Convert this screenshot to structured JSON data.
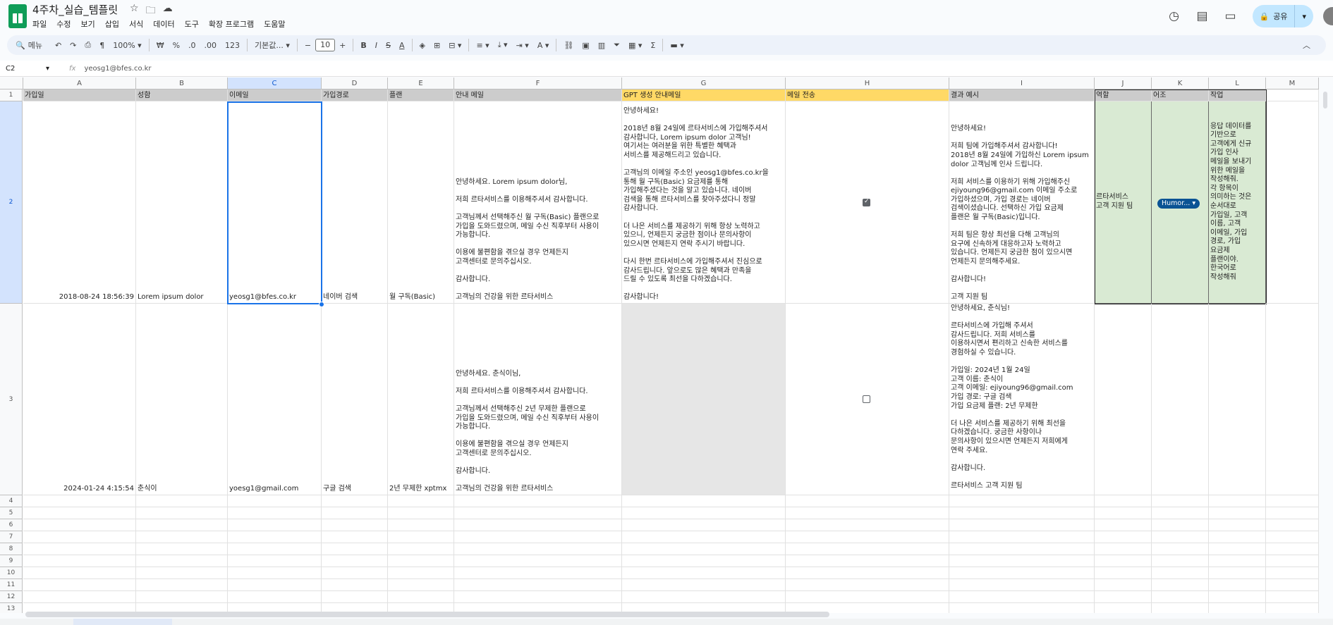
{
  "title": "4주차_실습_템플릿",
  "title_icons": [
    "star-icon",
    "folder-icon",
    "cloud-icon"
  ],
  "menu": [
    "파일",
    "수정",
    "보기",
    "삽입",
    "서식",
    "데이터",
    "도구",
    "확장 프로그램",
    "도움말"
  ],
  "share_label": "공유",
  "toolbar": {
    "search": "메뉴",
    "zoom": "100%",
    "currency": "₩",
    "percent": "%",
    "dec_decrease": ".0",
    "dec_increase": ".00",
    "number_format": "123",
    "font": "기본값...",
    "font_size": "10"
  },
  "name_box": "C2",
  "formula_value": "yeosg1@bfes.co.kr",
  "columns": [
    "A",
    "B",
    "C",
    "D",
    "E",
    "F",
    "G",
    "H",
    "I",
    "J",
    "K",
    "L",
    "M"
  ],
  "row_numbers": [
    "1",
    "2",
    "3",
    "4",
    "5",
    "6",
    "7",
    "8",
    "9",
    "10",
    "11",
    "12",
    "13"
  ],
  "headers": [
    "가입일",
    "성함",
    "이메일",
    "가입경로",
    "플랜",
    "안내 메일",
    "GPT 생성 안내메일",
    "메일 전송",
    "결과 예시",
    "역할",
    "어조",
    "작업"
  ],
  "row2": {
    "date": "2018-08-24 18:56:39",
    "name": "Lorem ipsum dolor",
    "email": "yeosg1@bfes.co.kr",
    "route": "네이버 검색",
    "plan": "월 구독(Basic)",
    "mail": "안녕하세요. Lorem ipsum dolor님,\n\n저희 르타서비스를 이용해주셔서 감사합니다.\n\n고객님께서 선택해주신 월 구독(Basic) 플랜으로\n가입을 도와드렸으며, 메일 수신 직후부터 사용이\n가능합니다.\n\n이용에 불편함을 겪으실 경우 언제든지\n고객센터로 문의주십시오.\n\n감사합니다.\n\n고객님의 건강을 위한 르타서비스",
    "gpt": "안녕하세요!\n\n2018년 8월 24일에 르타서비스에 가입해주셔서\n감사합니다, Lorem ipsum dolor 고객님!\n여기서는 여러분을 위한 특별한 혜택과\n서비스를 제공해드리고 있습니다.\n\n고객님의 이메일 주소인 yeosg1@bfes.co.kr을\n통해 월 구독(Basic) 요금제를 통해\n가입해주셨다는 것을 알고 있습니다. 네이버\n검색을 통해 르타서비스를 찾아주셨다니 정말\n감사합니다.\n\n더 나은 서비스를 제공하기 위해 항상 노력하고\n있으니, 언제든지 궁금한 점이나 문의사항이\n있으시면 언제든지 연락 주시기 바랍니다.\n\n다시 한번 르타서비스에 가입해주셔서 진심으로\n감사드립니다. 앞으로도 많은 혜택과 만족을\n드릴 수 있도록 최선을 다하겠습니다.\n\n감사합니다!",
    "sent": true,
    "example": "안녕하세요!\n\n저희 팀에 가입해주셔서 감사합니다!\n2018년 8월 24일에 가입하신 Lorem ipsum\ndolor 고객님께 인사 드립니다.\n\n저희 서비스를 이용하기 위해 가입해주신\nejiyoung96@gmail.com 이메일 주소로\n가입하셨으며, 가입 경로는 네이버\n검색이셨습니다. 선택하신 가입 요금제\n플랜은 월 구독(Basic)입니다.\n\n저희 팀은 항상 최선을 다해 고객님의\n요구에 신속하게 대응하고자 노력하고\n있습니다. 언제든지 궁금한 점이 있으시면\n언제든지 문의해주세요.\n\n감사합니다!\n\n고객 지원 팀",
    "role": "르타서비스\n고객 지원 팀",
    "tone": "Humor...",
    "task": "응답 데이터를\n기반으로\n고객에게 신규\n가입 인사\n메일을 보내기\n위한 메일을\n작성해줘.\n각 항목이\n의미하는 것은\n순서대로\n가입일, 고객\n이름, 고객\n이메일, 가입\n경로, 가입\n요금제\n플랜이야.\n한국어로\n작성해줘"
  },
  "row3": {
    "date": "2024-01-24 4:15:54",
    "name": "춘식이",
    "email": "yoesg1@gmail.com",
    "route": "구글 검색",
    "plan": "2년 무제한 xptmx",
    "mail": "안녕하세요. 춘식이님,\n\n저희 르타서비스를 이용해주셔서 감사합니다.\n\n고객님께서 선택해주신 2년 무제한 플랜으로\n가입을 도와드렸으며, 메일 수신 직후부터 사용이\n가능합니다.\n\n이용에 불편함을 겪으실 경우 언제든지\n고객센터로 문의주십시오.\n\n감사합니다.\n\n고객님의 건강을 위한 르타서비스",
    "sent": false,
    "example": "안녕하세요, 춘식님!\n\n르타서비스에 가입해 주셔서\n감사드립니다. 저희 서비스를\n이용하시면서 편리하고 신속한 서비스를\n경험하실 수 있습니다.\n\n가입일: 2024년 1월 24일\n고객 이름: 춘식이\n고객 이메일: ejiyoung96@gmail.com\n가입 경로: 구글 검색\n가입 요금제 플랜: 2년 무제한\n\n더 나은 서비스를 제공하기 위해 최선을\n다하겠습니다. 궁금한 사항이나\n문의사항이 있으시면 언제든지 저희에게\n연락 주세요.\n\n감사합니다.\n\n르타서비스 고객 지원 팀"
  }
}
